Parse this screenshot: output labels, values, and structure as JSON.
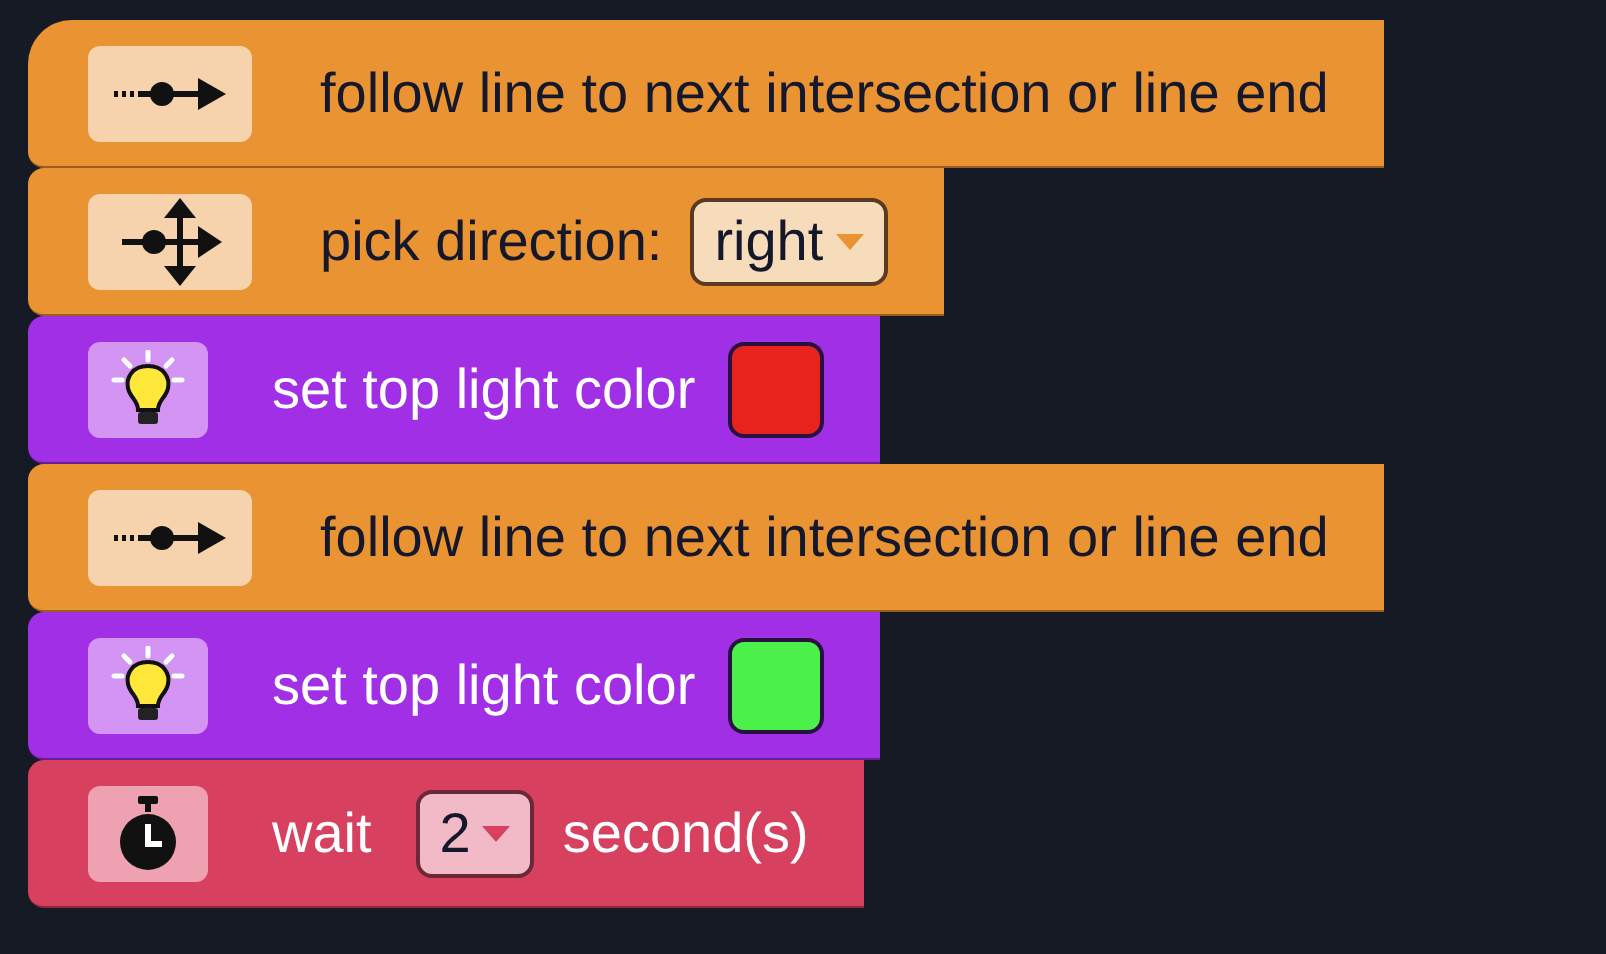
{
  "blocks": [
    {
      "kind": "follow",
      "label": "follow line to next intersection or line end"
    },
    {
      "kind": "direction",
      "label": "pick direction:",
      "dropdown": "right"
    },
    {
      "kind": "light",
      "label": "set top light color",
      "color": "#e8231e"
    },
    {
      "kind": "follow",
      "label": "follow line to next intersection or line end"
    },
    {
      "kind": "light",
      "label": "set top light color",
      "color": "#4cf04a"
    },
    {
      "kind": "wait",
      "label": "wait",
      "dropdown": "2",
      "suffix": "second(s)"
    }
  ]
}
